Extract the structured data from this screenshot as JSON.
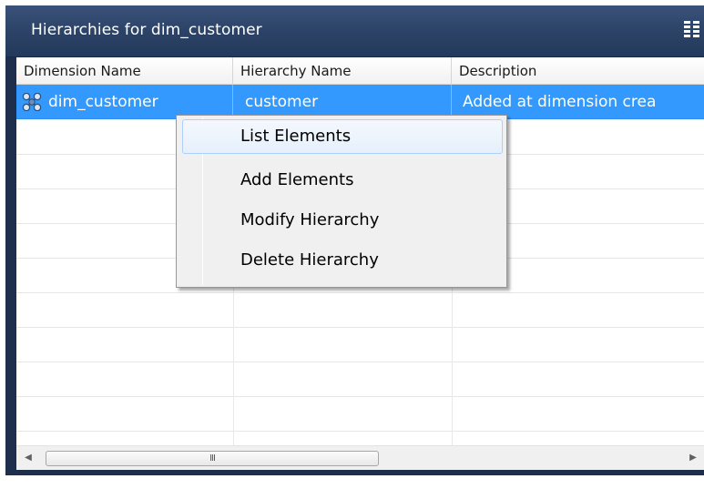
{
  "panel": {
    "title": "Hierarchies for dim_customer"
  },
  "table": {
    "columns": [
      "Dimension Name",
      "Hierarchy Name",
      "Description"
    ],
    "rows": [
      {
        "dimension_name": "dim_customer",
        "hierarchy_name": "customer",
        "description": "Added at dimension crea",
        "selected": true
      }
    ]
  },
  "context_menu": {
    "items": [
      "List Elements",
      "Add Elements",
      "Modify Hierarchy",
      "Delete Hierarchy"
    ],
    "highlighted_index": 0
  },
  "scrollbar": {
    "grip": "III"
  },
  "colors": {
    "title_bar": "#2b4266",
    "selection": "#3399ff",
    "menu_background": "#f0f0f0"
  },
  "icons": {
    "dimension_row": "dimension-icon",
    "title_menu": "grip-icon"
  }
}
